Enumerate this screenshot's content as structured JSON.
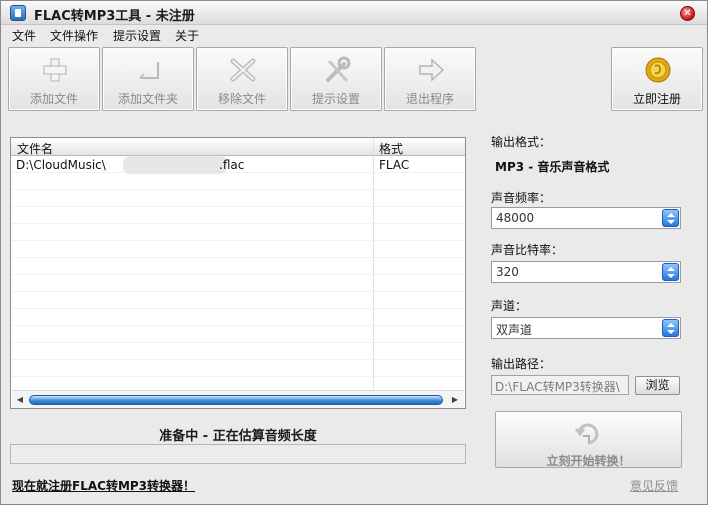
{
  "window": {
    "title": "FLAC转MP3工具 - 未注册",
    "close_glyph": "✕"
  },
  "menu": [
    "文件",
    "文件操作",
    "提示设置",
    "关于"
  ],
  "toolbar": {
    "add_file": "添加文件",
    "add_folder": "添加文件夹",
    "remove_file": "移除文件",
    "tip_settings": "提示设置",
    "exit": "退出程序",
    "register": "立即注册"
  },
  "file_list": {
    "columns": [
      "文件名",
      "格式"
    ],
    "rows": [
      {
        "name_prefix": "D:\\CloudMusic\\",
        "name_suffix": ".flac",
        "format": "FLAC"
      }
    ]
  },
  "status": {
    "message": "准备中 - 正在估算音频长度",
    "progress": 0
  },
  "footer": {
    "register_link": "现在就注册FLAC转MP3转换器！",
    "feedback_link": "意见反馈"
  },
  "settings": {
    "output_format_label": "输出格式：",
    "output_format_value": "MP3 - 音乐声音格式",
    "sample_rate_label": "声音频率：",
    "sample_rate_value": "48000",
    "bitrate_label": "声音比特率：",
    "bitrate_value": "320",
    "channel_label": "声道：",
    "channel_value": "双声道",
    "output_path_label": "输出路径：",
    "output_path_value": "D:\\FLAC转MP3转换器\\",
    "browse_label": "浏览",
    "convert_label": "立刻开始转换！"
  },
  "icons": [
    "app-icon",
    "add-file-icon",
    "add-folder-icon",
    "remove-file-icon",
    "settings-icon",
    "exit-icon",
    "coin-icon",
    "convert-icon"
  ]
}
